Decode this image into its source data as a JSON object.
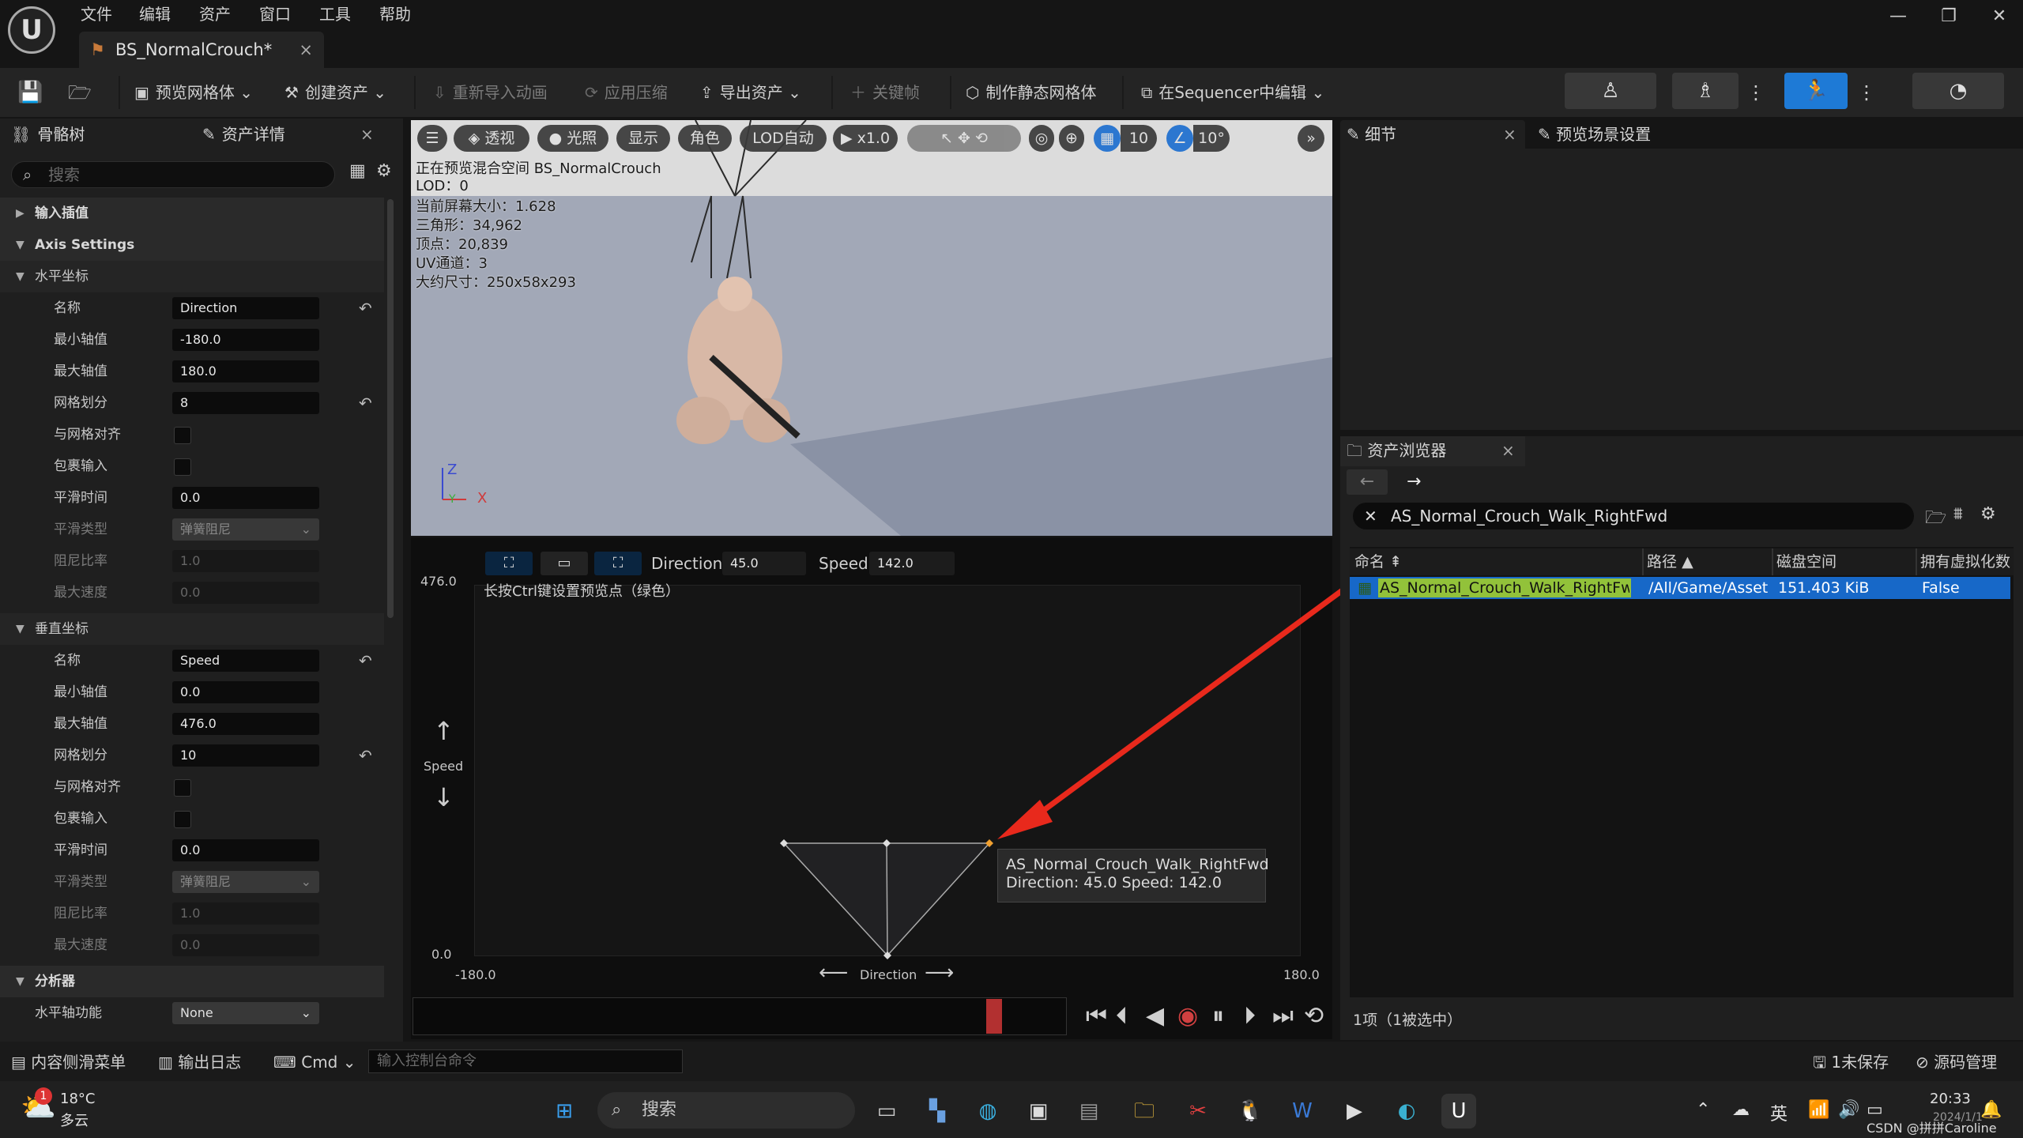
{
  "menu": [
    "文件",
    "编辑",
    "资产",
    "窗口",
    "工具",
    "帮助"
  ],
  "tab": {
    "title": "BS_NormalCrouch*",
    "close": "×"
  },
  "window_controls": {
    "minimize": "—",
    "restore": "❐",
    "close": "✕"
  },
  "toolbar": {
    "preview_mesh": "预览网格体",
    "create_asset": "创建资产",
    "reimport_anim": "重新导入动画",
    "apply_compression": "应用压缩",
    "export_asset": "导出资产",
    "keyframe": "关键帧",
    "make_static_mesh": "制作静态网格体",
    "edit_in_sequencer": "在Sequencer中编辑"
  },
  "left": {
    "tab_skeleton": "骨骼树",
    "tab_asset_details": "资产详情",
    "search_placeholder": "搜索",
    "input_interp": "输入插值",
    "axis_settings": "Axis Settings",
    "h_axis": "水平坐标",
    "v_axis": "垂直坐标",
    "analyzer": "分析器",
    "labels": {
      "name": "名称",
      "min": "最小轴值",
      "max": "最大轴值",
      "grid": "网格划分",
      "snap": "与网格对齐",
      "wrap": "包裹输入",
      "smooth_time": "平滑时间",
      "smooth_type": "平滑类型",
      "damping": "阻尼比率",
      "max_speed": "最大速度",
      "h_func": "水平轴功能"
    },
    "h": {
      "name": "Direction",
      "min": "-180.0",
      "max": "180.0",
      "grid": "8",
      "smooth_time": "0.0",
      "smooth_type": "弹簧阻尼",
      "damping": "1.0",
      "max_speed": "0.0"
    },
    "v": {
      "name": "Speed",
      "min": "0.0",
      "max": "476.0",
      "grid": "10",
      "smooth_time": "0.0",
      "smooth_type": "弹簧阻尼",
      "damping": "1.0",
      "max_speed": "0.0"
    },
    "h_func_value": "None"
  },
  "viewport": {
    "buttons": {
      "perspective": "透视",
      "lit": "光照",
      "show": "显示",
      "character": "角色",
      "lod": "LOD自动",
      "speed": "x1.0",
      "grid": "10",
      "angle": "10°"
    },
    "info": [
      "正在预览混合空间 BS_NormalCrouch",
      "LOD：0",
      "当前屏幕大小：1.628",
      "三角形：34,962",
      "顶点：20,839",
      "UV通道：3",
      "大约尺寸：250x58x293"
    ],
    "axis": {
      "z": "Z",
      "x": "X",
      "y": "Y"
    }
  },
  "blendspace": {
    "direction_label": "Direction",
    "direction_value": "45.0",
    "speed_label": "Speed",
    "speed_value": "142.0",
    "hint": "长按Ctrl键设置预览点（绿色）",
    "y_max": "476.0",
    "y_min": "0.0",
    "x_min": "-180.0",
    "x_max": "180.0",
    "y_axis": "Speed",
    "x_axis": "Direction",
    "tooltip_name": "AS_Normal_Crouch_Walk_RightFwd",
    "tooltip_values": "Direction: 45.0  Speed: 142.0"
  },
  "details": {
    "tab": "细节",
    "tab2": "预览场景设置"
  },
  "asset_browser": {
    "tab": "资产浏览器",
    "search": "AS_Normal_Crouch_Walk_RightFwd",
    "columns": [
      "命名",
      "路径",
      "磁盘空间",
      "拥有虚拟化数"
    ],
    "row": {
      "name": "AS_Normal_Crouch_Walk_RightFwd",
      "path": "/All/Game/Asset",
      "size": "151.403 KiB",
      "virtualized": "False"
    },
    "status": "1项（1被选中）"
  },
  "statusbar": {
    "content_drawer": "内容侧滑菜单",
    "output_log": "输出日志",
    "cmd": "Cmd",
    "console_placeholder": "输入控制台命令",
    "unsaved": "1未保存",
    "source_control": "源码管理"
  },
  "taskbar": {
    "temp": "18°C",
    "weather": "多云",
    "badge": "1",
    "search": "搜索",
    "ime": "英",
    "time": "20:33",
    "date": "2024/1/1",
    "watermark": "CSDN @拼拼Caroline"
  }
}
